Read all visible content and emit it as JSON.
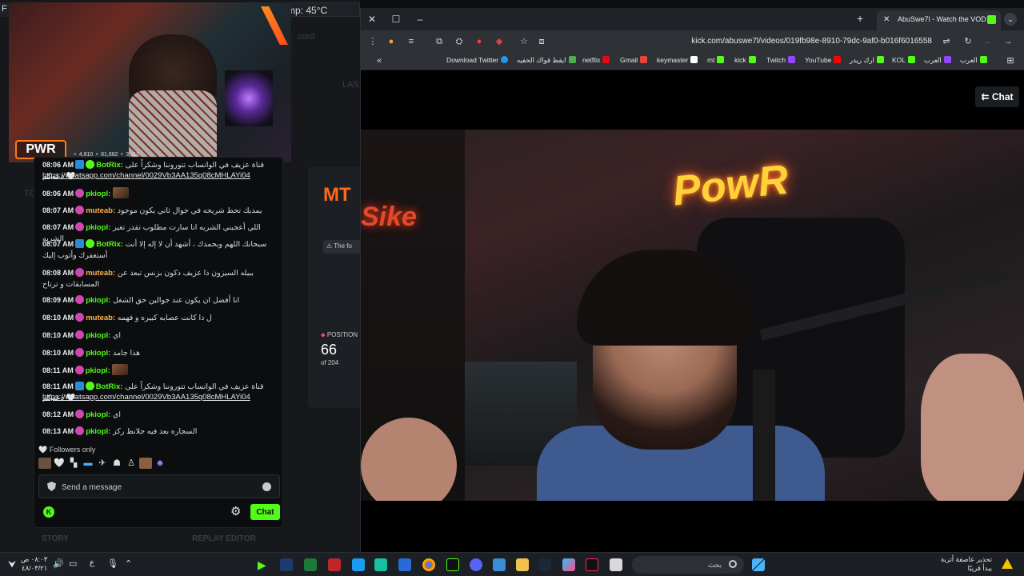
{
  "overlay": {
    "temp": "mp: 45°C",
    "corner": "F",
    "bg_hint_cord": "cord",
    "bg_hint_last": "LAS",
    "bg_hint_to": "TO",
    "webcam_logo": "PWR",
    "webcam_stats": "⚬ 4,810 ⚬ 81,682 ⚬ 3,110"
  },
  "chat": {
    "messages": [
      {
        "time": "08:06 AM",
        "user": "BotRix:",
        "text": "قناة عزيف في الواتساب تتوروننا وشكراً على دعمكم 🤍"
      },
      {
        "time": "",
        "user": "",
        "text": "https://whatsapp.com/channel/0029Vb3AA135q08cMHLAYi04"
      },
      {
        "time": "08:06 AM",
        "user": "pkiopl:",
        "text": ""
      },
      {
        "time": "08:07 AM",
        "user": "muteab:",
        "text": "يمديك تحط شريحه في جوال ثاني يكون موجود"
      },
      {
        "time": "08:07 AM",
        "user": "pkiopl:",
        "text": "اللي أعجبني الشريه انا سارت مطلوب تقدر تغير الشريه"
      },
      {
        "time": "08:07 AM",
        "user": "BotRix:",
        "text": "سبحانك اللهم وبحمدك ، أشهد أن لا إله إلا أنت أستغفرك وأتوب إليك"
      },
      {
        "time": "08:08 AM",
        "user": "muteab:",
        "text": "ببيله السيزون ذا عزيف ذكون بزنس تبعد عن المسابقات و ترتاح"
      },
      {
        "time": "08:09 AM",
        "user": "pkiopl:",
        "text": "انا أفضل ان يكون عند جوالين حق الشغل"
      },
      {
        "time": "08:10 AM",
        "user": "muteab:",
        "text": "ل دا كانت عصابه كبيره و فهمه"
      },
      {
        "time": "08:10 AM",
        "user": "pkiopl:",
        "text": "اي"
      },
      {
        "time": "08:10 AM",
        "user": "pkiopl:",
        "text": "هذا جامد"
      },
      {
        "time": "08:11 AM",
        "user": "pkiopl:",
        "text": ""
      },
      {
        "time": "08:11 AM",
        "user": "BotRix:",
        "text": "قناة عزيف في الواتساب تتوروننا وشكراً على دعمكم 🤍"
      },
      {
        "time": "",
        "user": "",
        "text": "https://whatsapp.com/channel/0029Vb3AA135q08cMHLAYi04"
      },
      {
        "time": "08:12 AM",
        "user": "pkiopl:",
        "text": "اي"
      },
      {
        "time": "08:13 AM",
        "user": "pkiopl:",
        "text": "السجاره بعد فيه جلانط ركز"
      }
    ],
    "followers_only": "Followers only",
    "send_placeholder": "Send a message",
    "chat_button": "Chat"
  },
  "behind": {
    "mt_logo": "MT",
    "notice": "The fo",
    "position_label": "POSITION",
    "position_value": "66",
    "position_of": "of 204",
    "story": "STORY",
    "replay_editor": "REPLAY EDITOR"
  },
  "browser": {
    "tab_title": "AbuSwe7l - Watch the VOD",
    "url": "kick.com/abuswe7l/videos/019fb98e-8910-79dc-9af0-b016f6016558",
    "bookmarks": [
      {
        "label": "Download Twitter",
        "color": "#1d9bf0"
      },
      {
        "label": "ايقظ قواك الخفيه",
        "color": "#4caf50"
      },
      {
        "label": "netflix",
        "color": "#e50914"
      },
      {
        "label": "Gmail",
        "color": "#ea4335"
      },
      {
        "label": "keymaster",
        "color": "#ffffff"
      },
      {
        "label": "mt",
        "color": "#53fc18"
      },
      {
        "label": "kick",
        "color": "#53fc18"
      },
      {
        "label": "Twitch",
        "color": "#9146ff"
      },
      {
        "label": "YouTube",
        "color": "#ff0000"
      },
      {
        "label": "ارك ريدر",
        "color": "#53fc18"
      },
      {
        "label": "KOL",
        "color": "#53fc18"
      },
      {
        "label": "العرب",
        "color": "#9146ff"
      },
      {
        "label": "العرب",
        "color": "#53fc18"
      }
    ],
    "chat_toggle": "Chat",
    "video_neon": "PowR",
    "video_neon2": "Sike"
  },
  "taskbar": {
    "search_placeholder": "بحث",
    "time": "٠٨:٠٣ ص",
    "date": "٤٨/٠٣/٢١",
    "lang": "ع",
    "weather_title": "تحذير عاصفة أتربة",
    "weather_sub": "يبدأ قريبًا"
  },
  "colors": {
    "kick_green": "#53fc18",
    "accent_orange": "#ff6a1a"
  }
}
